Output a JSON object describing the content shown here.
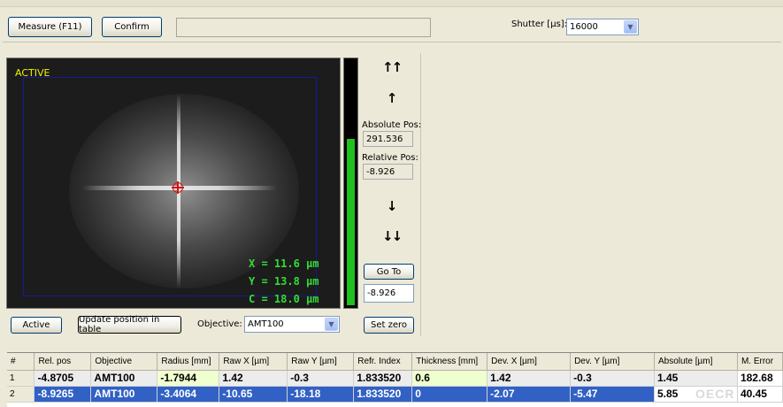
{
  "toolbar": {
    "measure_label": "Measure (F11)",
    "confirm_label": "Confirm",
    "shutter_label": "Shutter [µs]:",
    "shutter_value": "16000"
  },
  "camera": {
    "status": "ACTIVE",
    "x_readout": "X = 11.6 µm",
    "y_readout": "Y = 13.8 µm",
    "c_readout": "C = 18.0 µm"
  },
  "focus_level": 0.68,
  "position": {
    "absolute_label": "Absolute Pos:",
    "absolute_value": "291.536",
    "relative_label": "Relative Pos:",
    "relative_value": "-8.926",
    "goto_label": "Go To",
    "goto_value": "-8.926",
    "set_zero_label": "Set zero",
    "up_fast_icon": "double-up-arrow",
    "up_icon": "up-arrow",
    "down_icon": "down-arrow",
    "down_fast_icon": "double-down-arrow"
  },
  "controls": {
    "active_label": "Active",
    "update_label": "Update position in table",
    "objective_label": "Objective:",
    "objective_value": "AMT100"
  },
  "table": {
    "columns": [
      "#",
      "Rel. pos",
      "Objective",
      "Radius [mm]",
      "Raw X [µm]",
      "Raw Y  [µm]",
      "Refr. Index",
      "Thickness [mm]",
      "Dev. X  [µm]",
      "Dev. Y  [µm]",
      "Absolute [µm]",
      "M. Error"
    ],
    "rows": [
      [
        "1",
        "-4.8705",
        "AMT100",
        "-1.7944",
        "1.42",
        "-0.3",
        "1.833520",
        "0.6",
        "1.42",
        "-0.3",
        "1.45",
        "182.68"
      ],
      [
        "2",
        "-8.9265",
        "AMT100",
        "-3.4064",
        "-10.65",
        "-18.18",
        "1.833520",
        "0",
        "-2.07",
        "-5.47",
        "5.85",
        "40.45"
      ]
    ]
  },
  "watermark": "OECR"
}
